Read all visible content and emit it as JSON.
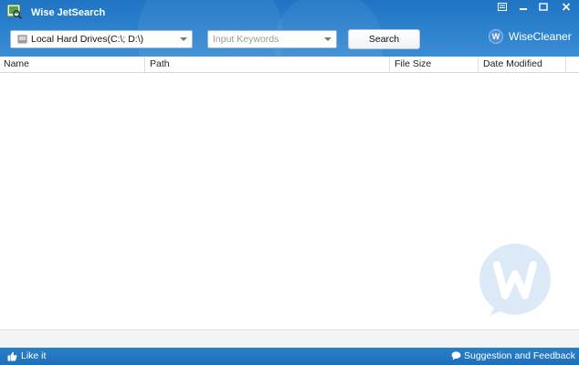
{
  "app": {
    "title": "Wise JetSearch"
  },
  "window_controls": {
    "menu_icon": "menu-icon",
    "minimize_icon": "minimize-icon",
    "maximize_icon": "maximize-icon",
    "close_icon": "close-icon"
  },
  "toolbar": {
    "drive_selected": "Local Hard Drives(C:\\; D:\\)",
    "keyword_placeholder": "Input Keywords",
    "keyword_value": "",
    "search_label": "Search"
  },
  "brand": {
    "icon_letter": "W",
    "name": "WiseCleaner"
  },
  "table": {
    "columns": [
      "Name",
      "Path",
      "File Size",
      "Date Modified"
    ],
    "rows": []
  },
  "footer": {
    "like_label": "Like it",
    "feedback_label": "Suggestion and Feedback"
  },
  "colors": {
    "header_blue": "#2a80cc",
    "footer_blue": "#1e6fba",
    "watermark_blue": "#dce9f7"
  }
}
